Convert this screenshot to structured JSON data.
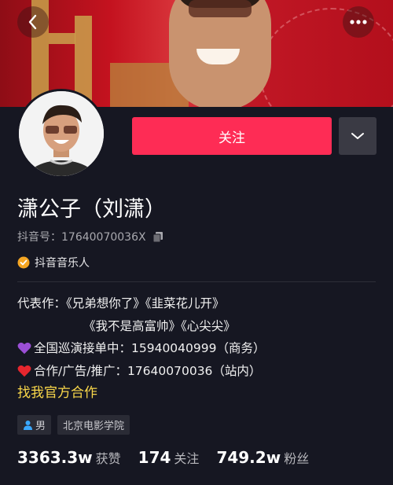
{
  "banner": {
    "back_icon": "chevron-left-icon",
    "more_icon": "more-horizontal-icon"
  },
  "profile": {
    "follow_label": "关注",
    "dropdown_icon": "chevron-down-icon",
    "name": "潇公子（刘潇）",
    "douyin_id": "抖音号：17640070036X",
    "copy_icon": "copy-icon",
    "verified_label": "抖音音乐人",
    "verified_icon": "verified-badge-icon",
    "accent": "#fe2c55",
    "link_color": "#f9d74a"
  },
  "bio": {
    "line1": "代表作：《兄弟想你了》《韭菜花儿开》",
    "line2": "《我不是高富帅》《心尖尖》",
    "line3": "全国巡演接单中：15940040999（商务）",
    "line4": "合作/广告/推广：17640070036（站内）",
    "line3_icon": "purple-heart-icon",
    "line4_icon": "red-heart-icon"
  },
  "link_text": "找我官方合作",
  "tags": {
    "gender": "男",
    "gender_icon": "male-user-icon",
    "school": "北京电影学院"
  },
  "stats": {
    "likes_value": "3363.3w",
    "likes_label": "获赞",
    "following_value": "174",
    "following_label": "关注",
    "followers_value": "749.2w",
    "followers_label": "粉丝"
  }
}
